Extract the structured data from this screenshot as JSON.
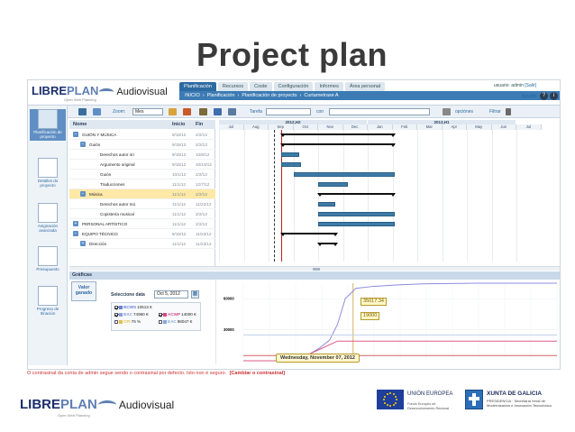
{
  "slide": {
    "title": "Project plan"
  },
  "app": {
    "logo": {
      "libre": "LIBRE",
      "plan": "PLAN",
      "audiovisual": "Audiovisual",
      "sub": "Open Web Planning"
    },
    "main_tabs": [
      "Planificación",
      "Recursos",
      "Coste",
      "Configuración",
      "Informes",
      "Área personal"
    ],
    "user_label": "usuario: admin",
    "logout": "[Salir]",
    "breadcrumbs": [
      "INICIO",
      "›",
      "Planificación",
      "›",
      "Planificación de proyecto",
      "›",
      "Curtametraxe A"
    ],
    "help_label": "Ayuda"
  },
  "left_nav": [
    {
      "label": "Planificación de proyecto",
      "active": true
    },
    {
      "label": "Detalles do proyecto",
      "active": false
    },
    {
      "label": "Asignación avanzada",
      "active": false
    },
    {
      "label": "Presupuesto",
      "active": false
    },
    {
      "label": "Progreso de Itinación",
      "active": false
    }
  ],
  "toolbar": {
    "zoom_label": "Zoom:",
    "zoom_value": "Mes",
    "filter_label": "Tarefa",
    "con_label": "con",
    "options_label": "opciónes",
    "filter_btn": "Filtrar"
  },
  "tree": {
    "columns": [
      "Nome",
      "Inicio",
      "Fin"
    ],
    "rows": [
      {
        "name": "GUIÓN Y MÚSICA",
        "start": "9/15/12",
        "end": "2/2/13",
        "level": 0,
        "expander": "−",
        "selected": false
      },
      {
        "name": "Guión",
        "start": "9/15/12",
        "end": "2/2/13",
        "level": 1,
        "expander": "−",
        "selected": false
      },
      {
        "name": "Derechos autor ori",
        "start": "9/15/12",
        "end": "10/8/12",
        "level": 2,
        "expander": "",
        "selected": false
      },
      {
        "name": "Argumento original",
        "start": "9/15/12",
        "end": "10/10/12",
        "level": 2,
        "expander": "",
        "selected": false
      },
      {
        "name": "Guión",
        "start": "10/1/12",
        "end": "2/2/13",
        "level": 2,
        "expander": "",
        "selected": false
      },
      {
        "name": "Traducciones",
        "start": "11/1/12",
        "end": "12/7/12",
        "level": 2,
        "expander": "",
        "selected": false
      },
      {
        "name": "Música",
        "start": "11/1/12",
        "end": "2/2/13",
        "level": 1,
        "expander": "−",
        "selected": true
      },
      {
        "name": "Derechos autor mú",
        "start": "11/1/12",
        "end": "11/22/12",
        "level": 2,
        "expander": "",
        "selected": false
      },
      {
        "name": "Copistería musical",
        "start": "11/1/12",
        "end": "2/2/13",
        "level": 2,
        "expander": "",
        "selected": false
      },
      {
        "name": "PERSONAL ARTÍSTICO",
        "start": "11/1/12",
        "end": "2/2/13",
        "level": 0,
        "expander": "+",
        "selected": false
      },
      {
        "name": "EQUIPO TÉCNICO",
        "start": "9/15/12",
        "end": "11/23/12",
        "level": 0,
        "expander": "−",
        "selected": false
      },
      {
        "name": "Dirección",
        "start": "11/1/12",
        "end": "11/23/12",
        "level": 1,
        "expander": "+",
        "selected": false
      }
    ]
  },
  "timeline": {
    "years": [
      {
        "label": "2012,H2",
        "from": 0,
        "to": 6
      },
      {
        "label": "2013,H1",
        "from": 6,
        "to": 12
      }
    ],
    "months": [
      "Jul",
      "Aug",
      "Sep",
      "Oct",
      "Nov",
      "Dec",
      "Jan",
      "Feb",
      "Mar",
      "Apr",
      "May",
      "Jun",
      "Jul"
    ],
    "today_month": 2.5,
    "dashed_month": 2.2,
    "tasks": [
      {
        "row": 0,
        "type": "summary",
        "start": 2.5,
        "end": 7.1
      },
      {
        "row": 1,
        "type": "summary",
        "start": 2.5,
        "end": 7.1
      },
      {
        "row": 2,
        "type": "bar",
        "start": 2.5,
        "end": 3.25
      },
      {
        "row": 3,
        "type": "bar",
        "start": 2.5,
        "end": 3.3
      },
      {
        "row": 4,
        "type": "bar",
        "start": 3.0,
        "end": 7.1
      },
      {
        "row": 5,
        "type": "bar",
        "start": 4.0,
        "end": 5.2
      },
      {
        "row": 6,
        "type": "summary",
        "start": 4.0,
        "end": 7.1
      },
      {
        "row": 7,
        "type": "bar",
        "start": 4.0,
        "end": 4.7
      },
      {
        "row": 8,
        "type": "bar",
        "start": 4.0,
        "end": 7.1
      },
      {
        "row": 9,
        "type": "bar",
        "start": 4.0,
        "end": 7.1
      },
      {
        "row": 10,
        "type": "summary",
        "start": 2.5,
        "end": 4.75
      },
      {
        "row": 11,
        "type": "summary",
        "start": 4.0,
        "end": 4.75
      }
    ]
  },
  "graphs": {
    "title": "Gráficas",
    "tab_label": "Valor ganado",
    "select_date_label": "Seleccione data",
    "date_value": "Oct 5, 2012",
    "metrics": [
      {
        "key": "BCWS",
        "value": "10613 €",
        "checked": true,
        "color": "#6a82d4"
      },
      {
        "key": "BAC",
        "value": "74960 €",
        "checked": true,
        "color": "#8aa0e0"
      },
      {
        "key": "ACWP",
        "value": "14000 €",
        "checked": true,
        "color": "#d24a8c"
      },
      {
        "key": "CPI",
        "value": "76 %",
        "checked": false,
        "color": "#e0c050"
      },
      {
        "key": "EAC",
        "value": "98047 €",
        "checked": false,
        "color": "#88a8d8"
      }
    ],
    "value_labels": [
      "35017.34",
      "19000"
    ],
    "date_tip": "Wednesday, November 07, 2012"
  },
  "chart_data": {
    "type": "line",
    "title": "",
    "xlabel": "",
    "ylabel": "",
    "y_ticks": [
      60000,
      30000
    ],
    "ylim": [
      0,
      75000
    ],
    "x_months": [
      "Jul",
      "Aug",
      "Sep",
      "Oct",
      "Nov",
      "Dec",
      "Jan",
      "Feb",
      "Mar",
      "Apr",
      "May",
      "Jun",
      "Jul"
    ],
    "series": [
      {
        "color": "#8c8ce0",
        "x": [
          0,
          2.0,
          2.3,
          2.9,
          3.3,
          3.6,
          3.9,
          4.3,
          5.0,
          6.0,
          7.0,
          9.0,
          12.0
        ],
        "y": [
          0,
          0,
          3000,
          12000,
          20000,
          35017.34,
          60000,
          70000,
          72000,
          73500,
          74500,
          74960,
          74960
        ]
      },
      {
        "color": "#e05a8a",
        "x": [
          0,
          2.0,
          2.4,
          3.0,
          3.6,
          4.0,
          5.0,
          12.0
        ],
        "y": [
          0,
          0,
          5000,
          12000,
          19000,
          19000,
          19000,
          19000
        ]
      },
      {
        "color": "#d66060",
        "x": [
          0,
          12.0
        ],
        "y": [
          5000,
          5000
        ]
      },
      {
        "color": "#c0d0e8",
        "x": [
          0,
          12.0
        ],
        "y": [
          25000,
          25000
        ]
      }
    ]
  },
  "footer": {
    "warning": "O contrasinal da conta de admin segue sendo o contrasinal por defecto. Isto non é seguro.",
    "warning_link": "[Cambiar o contrasinal]",
    "logo": {
      "libre": "LIBRE",
      "plan": "PLAN",
      "audiovisual": "Audiovisual",
      "sub": "Open Web Planning"
    },
    "eu_title": "UNIÓN EUROPEA",
    "eu_sub": "Fondo Europeo de Desenvolvemento Rexional",
    "xunta_title": "XUNTA DE GALICIA",
    "xunta_sub": "PRESIDENCIA · Secretaría Xeral de Modernización e Innovación Tecnolóxica"
  }
}
